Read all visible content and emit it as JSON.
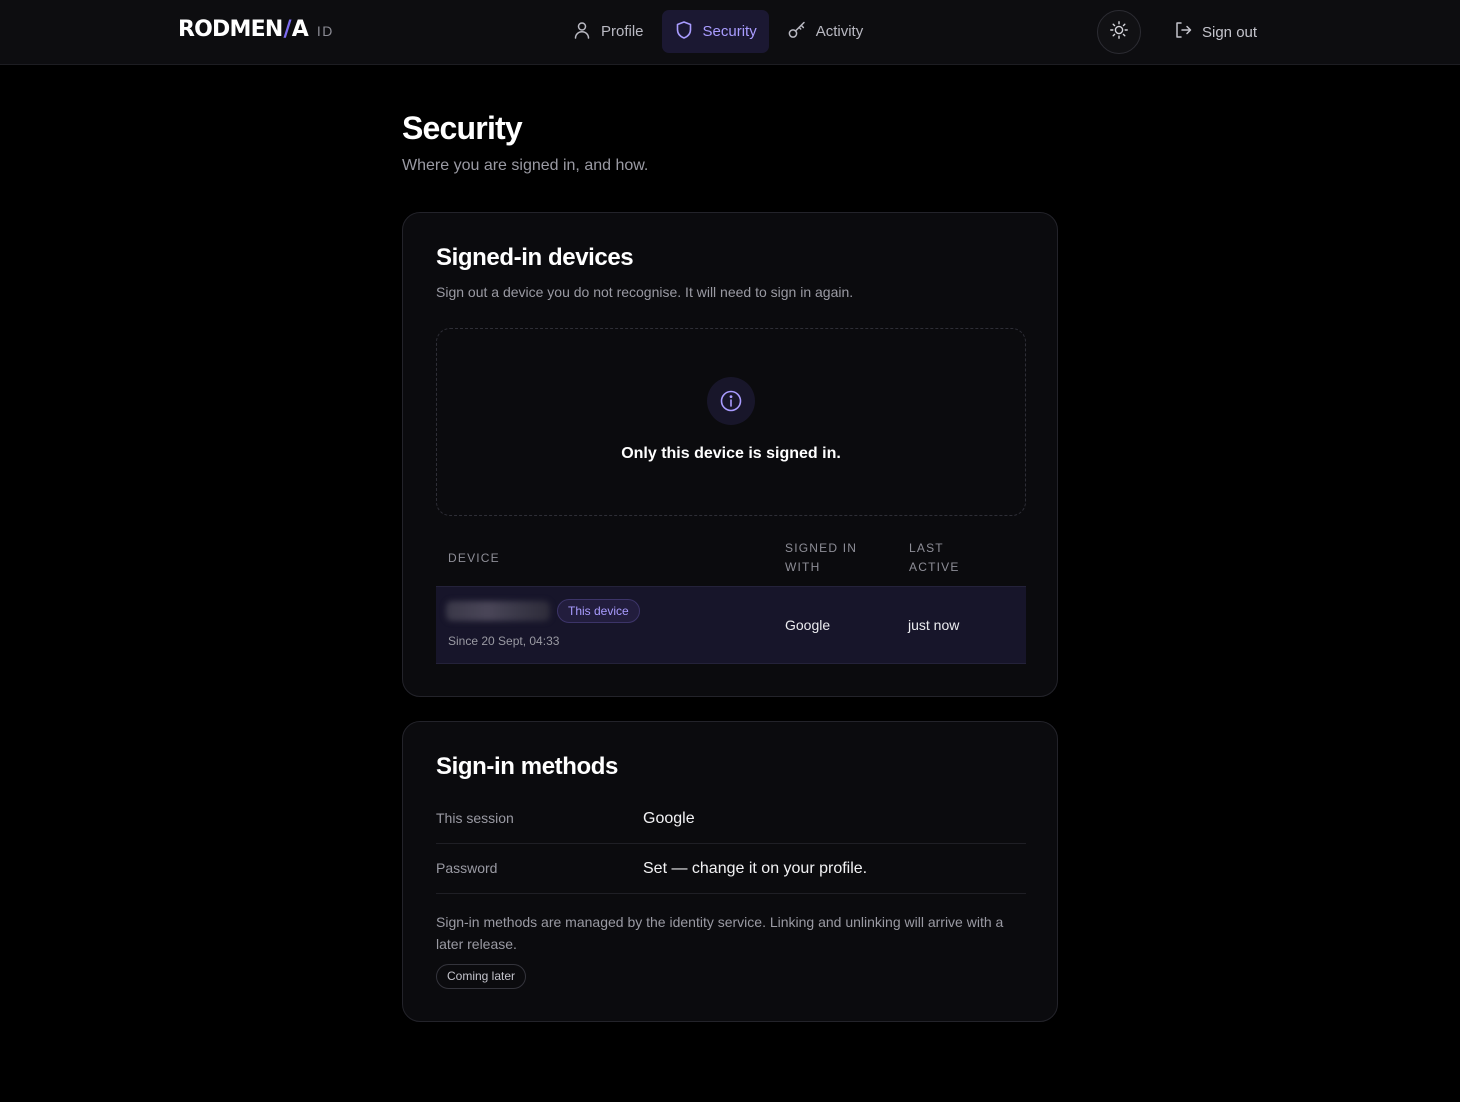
{
  "brand": {
    "name_left": "RODMEN",
    "slash": "/",
    "name_right": "A",
    "suffix": "ID"
  },
  "nav": {
    "items": [
      {
        "label": "Profile",
        "icon": "user-icon",
        "active": false
      },
      {
        "label": "Security",
        "icon": "shield-icon",
        "active": true
      },
      {
        "label": "Activity",
        "icon": "key-icon",
        "active": false
      }
    ]
  },
  "header": {
    "theme_toggle_icon": "sun-icon",
    "signout_label": "Sign out",
    "signout_icon": "sign-out-icon"
  },
  "page": {
    "title": "Security",
    "subtitle": "Where you are signed in, and how."
  },
  "devices": {
    "title": "Signed-in devices",
    "description": "Sign out a device you do not recognise. It will need to sign in again.",
    "empty_icon": "info-icon",
    "empty_text": "Only this device is signed in.",
    "columns": {
      "device": "DEVICE",
      "signed_in_with": "SIGNED IN WITH",
      "last_active": "LAST ACTIVE"
    },
    "rows": [
      {
        "badge": "This device",
        "since": "Since 20 Sept, 04:33",
        "signed_in_with": "Google",
        "last_active": "just now"
      }
    ]
  },
  "methods": {
    "title": "Sign-in methods",
    "rows": [
      {
        "label": "This session",
        "value": "Google"
      },
      {
        "label": "Password",
        "value": "Set — change it on your profile."
      }
    ],
    "note": "Sign-in methods are managed by the identity service. Linking and unlinking will arrive with a later release.",
    "badge": "Coming later"
  },
  "colors": {
    "accent": "#a99cff",
    "brand_slash": "#7c6cf0",
    "background": "#000000",
    "card": "#0b0b0e"
  }
}
